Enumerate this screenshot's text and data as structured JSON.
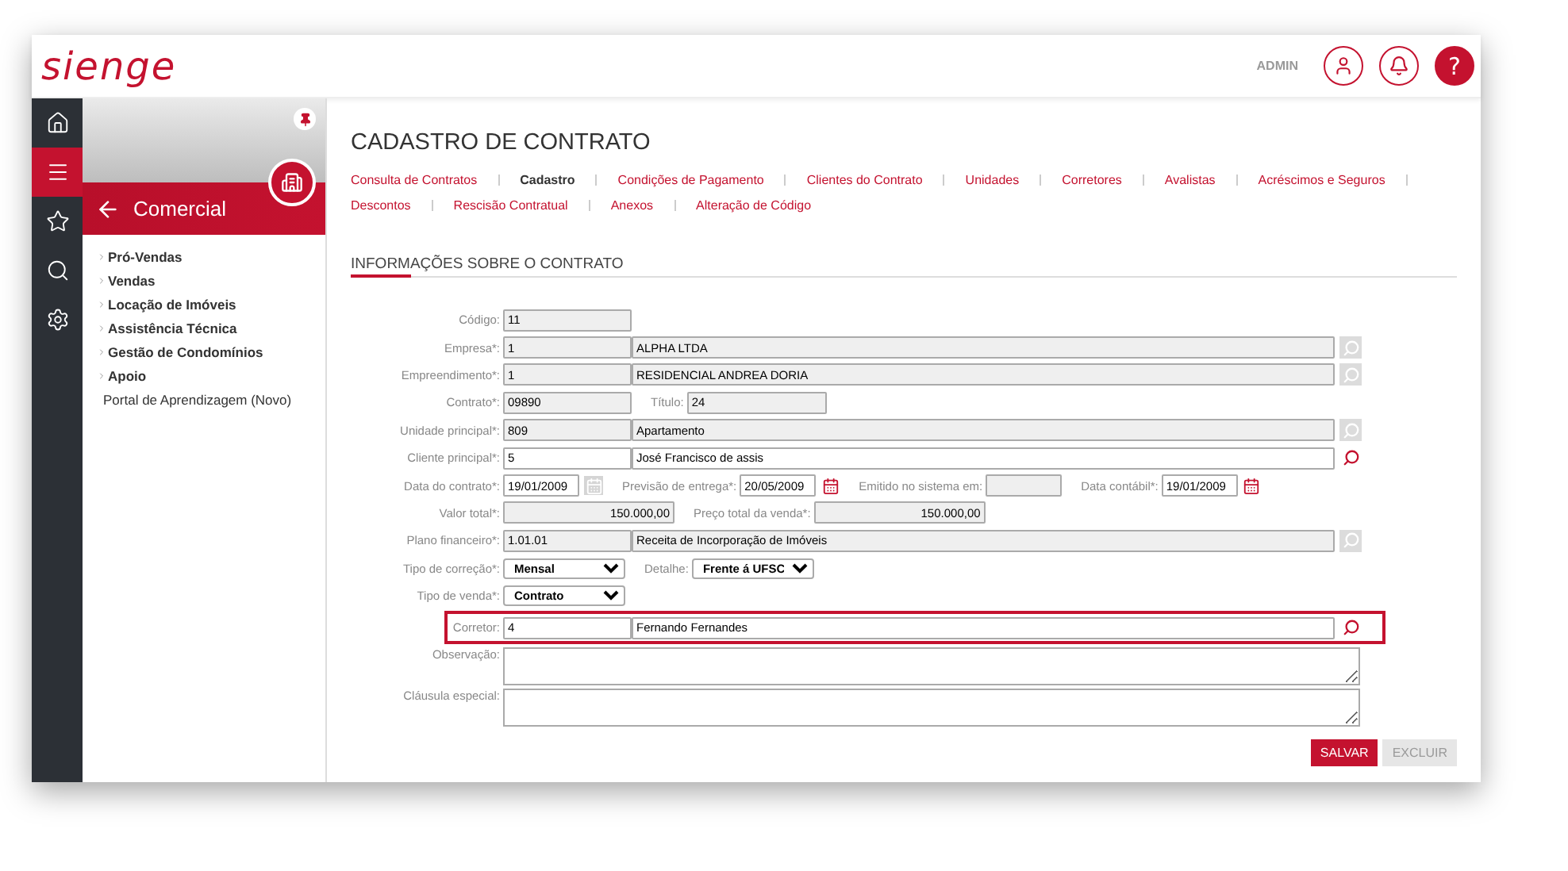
{
  "header": {
    "logo": "sienge",
    "user": "ADMIN",
    "help": "?"
  },
  "rail": [
    {
      "kind": "home",
      "selected": false
    },
    {
      "kind": "menu",
      "selected": true
    },
    {
      "kind": "star",
      "selected": false
    },
    {
      "kind": "search",
      "selected": false
    },
    {
      "kind": "settings",
      "selected": false
    }
  ],
  "sidebar": {
    "title": "Comercial",
    "items": [
      {
        "label": "Pró-Vendas",
        "kind": "group"
      },
      {
        "label": "Vendas",
        "kind": "group"
      },
      {
        "label": "Locação de Imóveis",
        "kind": "group"
      },
      {
        "label": "Assistência Técnica",
        "kind": "group"
      },
      {
        "label": "Gestão de Condomínios",
        "kind": "group"
      },
      {
        "label": "Apoio",
        "kind": "group"
      },
      {
        "label": "Portal de Aprendizagem (Novo)",
        "kind": "link"
      }
    ]
  },
  "page": {
    "title": "CADASTRO DE CONTRATO",
    "section": "INFORMAÇÕES SOBRE O CONTRATO"
  },
  "tabs": [
    {
      "label": "Consulta de Contratos",
      "selected": false
    },
    {
      "label": "Cadastro",
      "selected": true
    },
    {
      "label": "Condições de Pagamento",
      "selected": false
    },
    {
      "label": "Clientes do Contrato",
      "selected": false
    },
    {
      "label": "Unidades",
      "selected": false
    },
    {
      "label": "Corretores",
      "selected": false
    },
    {
      "label": "Avalistas",
      "selected": false
    },
    {
      "label": "Acréscimos e Seguros",
      "selected": false
    },
    {
      "label": "Descontos",
      "selected": false
    },
    {
      "label": "Rescisão Contratual",
      "selected": false
    },
    {
      "label": "Anexos",
      "selected": false
    },
    {
      "label": "Alteração de Código",
      "selected": false
    }
  ],
  "form": [
    {
      "label": "Código:",
      "highlighted": false,
      "items": [
        {
          "kind": "code",
          "value": "11",
          "readonly": true
        }
      ]
    },
    {
      "label": "Empresa*:",
      "highlighted": false,
      "items": [
        {
          "kind": "code",
          "value": "1",
          "readonly": true
        },
        {
          "kind": "name",
          "value": "ALPHA LTDA",
          "readonly": true
        },
        {
          "kind": "search",
          "enabled": false
        }
      ]
    },
    {
      "label": "Empreendimento*:",
      "highlighted": false,
      "items": [
        {
          "kind": "code",
          "value": "1",
          "readonly": true
        },
        {
          "kind": "name",
          "value": "RESIDENCIAL ANDREA DORIA",
          "readonly": true
        },
        {
          "kind": "search",
          "enabled": false
        }
      ]
    },
    {
      "label": "Contrato*:",
      "highlighted": false,
      "items": [
        {
          "kind": "code",
          "value": "09890",
          "readonly": true
        },
        {
          "kind": "label",
          "text": "Título:"
        },
        {
          "kind": "short",
          "value": "24",
          "readonly": true
        }
      ]
    },
    {
      "label": "Unidade principal*:",
      "highlighted": false,
      "items": [
        {
          "kind": "code",
          "value": "809",
          "readonly": true
        },
        {
          "kind": "name",
          "value": "Apartamento",
          "readonly": true
        },
        {
          "kind": "search",
          "enabled": false
        }
      ]
    },
    {
      "label": "Cliente principal*:",
      "highlighted": false,
      "items": [
        {
          "kind": "code",
          "value": "5",
          "readonly": false
        },
        {
          "kind": "name",
          "value": "José Francisco de assis",
          "readonly": false
        },
        {
          "kind": "search",
          "enabled": true
        }
      ]
    },
    {
      "label": "Data do contrato*:",
      "highlighted": false,
      "items": [
        {
          "kind": "date",
          "value": "19/01/2009",
          "readonly": false
        },
        {
          "kind": "calendar",
          "enabled": false
        },
        {
          "kind": "label",
          "text": "Previsão de entrega*:"
        },
        {
          "kind": "date",
          "value": "20/05/2009",
          "readonly": false
        },
        {
          "kind": "calendar",
          "enabled": true
        },
        {
          "kind": "label",
          "text": "Emitido no sistema em:"
        },
        {
          "kind": "date",
          "readonly": true
        },
        {
          "kind": "label",
          "text": "Data contábil*:"
        },
        {
          "kind": "date",
          "value": "19/01/2009",
          "readonly": false
        },
        {
          "kind": "calendar",
          "enabled": true
        }
      ]
    },
    {
      "label": "Valor total*:",
      "highlighted": false,
      "items": [
        {
          "kind": "money",
          "value": "150.000,00",
          "readonly": true
        },
        {
          "kind": "label",
          "text": "Preço total da venda*:"
        },
        {
          "kind": "money",
          "value": "150.000,00",
          "readonly": true
        }
      ]
    },
    {
      "label": "Plano financeiro*:",
      "highlighted": false,
      "items": [
        {
          "kind": "code",
          "value": "1.01.01",
          "readonly": true
        },
        {
          "kind": "name",
          "value": "Receita de Incorporação de Imóveis",
          "readonly": true
        },
        {
          "kind": "search",
          "enabled": false
        }
      ]
    },
    {
      "label": "Tipo de correção*:",
      "highlighted": false,
      "items": [
        {
          "kind": "select",
          "value": "Mensal"
        },
        {
          "kind": "label",
          "text": "Detalhe:"
        },
        {
          "kind": "select",
          "value": "Frente á UFSC"
        }
      ]
    },
    {
      "label": "Tipo de venda*:",
      "highlighted": false,
      "items": [
        {
          "kind": "select",
          "value": "Contrato"
        }
      ]
    },
    {
      "label": "Corretor:",
      "highlighted": true,
      "items": [
        {
          "kind": "code",
          "value": "4",
          "readonly": false
        },
        {
          "kind": "name",
          "value": "Fernando Fernandes",
          "readonly": false
        },
        {
          "kind": "search",
          "enabled": true
        }
      ]
    },
    {
      "label": "Observação:",
      "highlighted": false,
      "items": [
        {
          "kind": "textarea"
        }
      ]
    },
    {
      "label": "Cláusula especial:",
      "highlighted": false,
      "items": [
        {
          "kind": "textarea"
        }
      ]
    }
  ],
  "buttons": [
    {
      "label": "SALVAR",
      "disabled": false
    },
    {
      "label": "EXCLUIR",
      "disabled": true
    }
  ]
}
